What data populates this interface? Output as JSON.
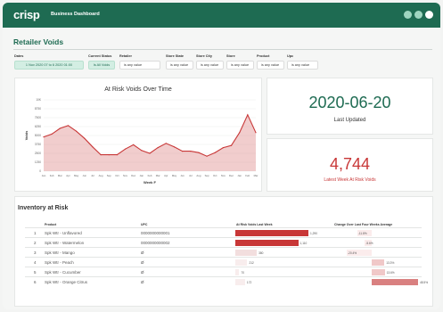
{
  "header": {
    "logo": "crisp",
    "title": "Business Dashboard"
  },
  "page_title": "Retailer Voids",
  "filters": [
    {
      "label": "Dates",
      "value": "1 Nov 2020 07 to 6 2020 01:00",
      "active": true
    },
    {
      "label": "Current Status",
      "value": "Is All Voids",
      "active": true
    },
    {
      "label": "Retailer",
      "value": "is any value",
      "active": false
    },
    {
      "label": "Store State",
      "value": "is any value",
      "active": false
    },
    {
      "label": "Store City",
      "value": "is any value",
      "active": false
    },
    {
      "label": "Store",
      "value": "is any value",
      "active": false
    },
    {
      "label": "Product",
      "value": "is any value",
      "active": false
    },
    {
      "label": "Upc",
      "value": "is any value",
      "active": false
    }
  ],
  "kpis": {
    "last_updated_value": "2020-06-20",
    "last_updated_label": "Last Updated",
    "voids_value": "4,744",
    "voids_label": "Latest Week At Risk Voids"
  },
  "chart_data": {
    "type": "area",
    "title": "At Risk Voids Over Time",
    "xlabel": "Week F",
    "ylabel": "Voids",
    "ylim": [
      0,
      10000
    ],
    "yticks": [
      "0",
      "1250",
      "2500",
      "3750",
      "5000",
      "6250",
      "7500",
      "8750",
      "10K"
    ],
    "x": [
      "Jan",
      "Feb",
      "Mar",
      "Apr",
      "May",
      "Jun",
      "Jul",
      "Aug",
      "Sep",
      "Oct",
      "Nov",
      "Dec",
      "Jan",
      "Feb",
      "Mar",
      "Apr",
      "May",
      "Jun",
      "Jul",
      "Aug",
      "Sep",
      "Oct",
      "Nov",
      "Dec",
      "Jan",
      "Feb",
      "Mar"
    ],
    "values": [
      4800,
      5200,
      6000,
      6400,
      5600,
      4600,
      3400,
      2300,
      2300,
      2300,
      3100,
      3700,
      2900,
      2500,
      3300,
      3900,
      3400,
      2800,
      2800,
      2600,
      2100,
      2600,
      3300,
      3600,
      5400,
      7900,
      5400
    ],
    "color": "#c83737"
  },
  "table": {
    "title": "Inventory at Risk",
    "headers": [
      "Product",
      "UPC",
      "At Risk Voids Last Week",
      "Change Over Last Four Weeks Average"
    ],
    "rows": [
      {
        "n": "1",
        "product": "Spk Wtr - Unflavored",
        "upc": "0000000000001",
        "risk": 1290,
        "risk_label": "1,290",
        "change": -11.8,
        "change_label": "-11.8%"
      },
      {
        "n": "2",
        "product": "Spk Wtr - Watermelon",
        "upc": "0000000000002",
        "risk": 1110,
        "risk_label": "1,110",
        "change": -5.6,
        "change_label": "-5.6%"
      },
      {
        "n": "3",
        "product": "Spk Wtr - Mango",
        "upc": "Ø",
        "risk": 380,
        "risk_label": "380",
        "change": -20.4,
        "change_label": "-20.4%"
      },
      {
        "n": "4",
        "product": "Spk Wtr - Peach",
        "upc": "Ø",
        "risk": 212,
        "risk_label": "212",
        "change": 13.3,
        "change_label": "13.3%"
      },
      {
        "n": "5",
        "product": "Spk Wtr - Cucumber",
        "upc": "Ø",
        "risk": 70,
        "risk_label": "70",
        "change": 13.6,
        "change_label": "13.6%"
      },
      {
        "n": "6",
        "product": "Spk Wtr - Orange Citrus",
        "upc": "Ø",
        "risk": 172,
        "risk_label": "172",
        "change": 48.5,
        "change_label": "48.5%"
      }
    ]
  }
}
